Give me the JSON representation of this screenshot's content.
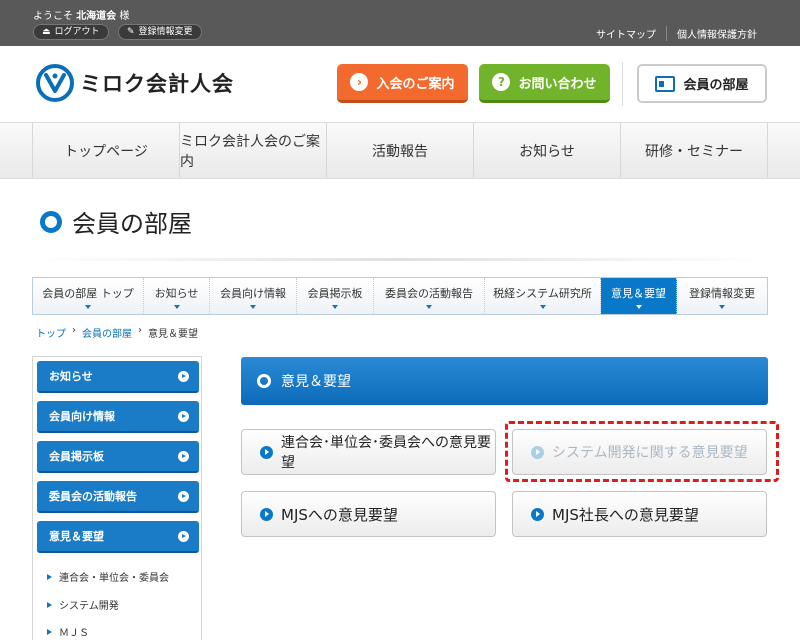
{
  "topbar": {
    "welcome_prefix": "ようこそ",
    "user_name": "北海道会",
    "welcome_suffix": "様",
    "logout_label": "ログアウト",
    "edit_profile_label": "登録情報変更",
    "links": [
      "サイトマップ",
      "個人情報保護方針"
    ]
  },
  "header": {
    "logo_text": "ミロク会計人会",
    "join_label": "入会のご案内",
    "contact_label": "お問い合わせ",
    "contact_icon_glyph": "?",
    "member_room_label": "会員の部屋"
  },
  "global_nav": [
    "トップページ",
    "ミロク会計人会のご案内",
    "活動報告",
    "お知らせ",
    "研修・セミナー"
  ],
  "page_title": "会員の部屋",
  "sub_nav": {
    "items": [
      "会員の部屋 トップ",
      "お知らせ",
      "会員向け情報",
      "会員掲示板",
      "委員会の活動報告",
      "税経システム研究所",
      "意見＆要望",
      "登録情報変更"
    ],
    "active": "意見＆要望"
  },
  "breadcrumb": {
    "items": [
      "トップ",
      "会員の部屋",
      "意見＆要望"
    ],
    "separator": "›"
  },
  "sidebar": {
    "buttons": [
      "お知らせ",
      "会員向け情報",
      "会員掲示板",
      "委員会の活動報告",
      "意見＆要望"
    ],
    "sub_items": [
      "連合会・単位会・委員会",
      "システム開発",
      "ＭＪＳ"
    ]
  },
  "main": {
    "heading": "意見＆要望",
    "options": [
      {
        "label": "連合会･単位会･委員会への意見要望",
        "state": "normal"
      },
      {
        "label": "システム開発に関する意見要望",
        "state": "disabled"
      },
      {
        "label": "MJSへの意見要望",
        "state": "normal"
      },
      {
        "label": "MJS社長への意見要望",
        "state": "normal"
      }
    ]
  },
  "colors": {
    "brand_blue": "#0a78c8",
    "join_orange": "#f26a2e",
    "contact_green": "#72b32c",
    "highlight_red": "#e01b1b",
    "topbar_gray": "#595959"
  },
  "icons": {
    "logout": "logout-icon",
    "edit": "pencil-icon",
    "join": "arrow-right-circle-icon",
    "contact": "question-circle-icon",
    "member_room": "id-card-icon"
  }
}
